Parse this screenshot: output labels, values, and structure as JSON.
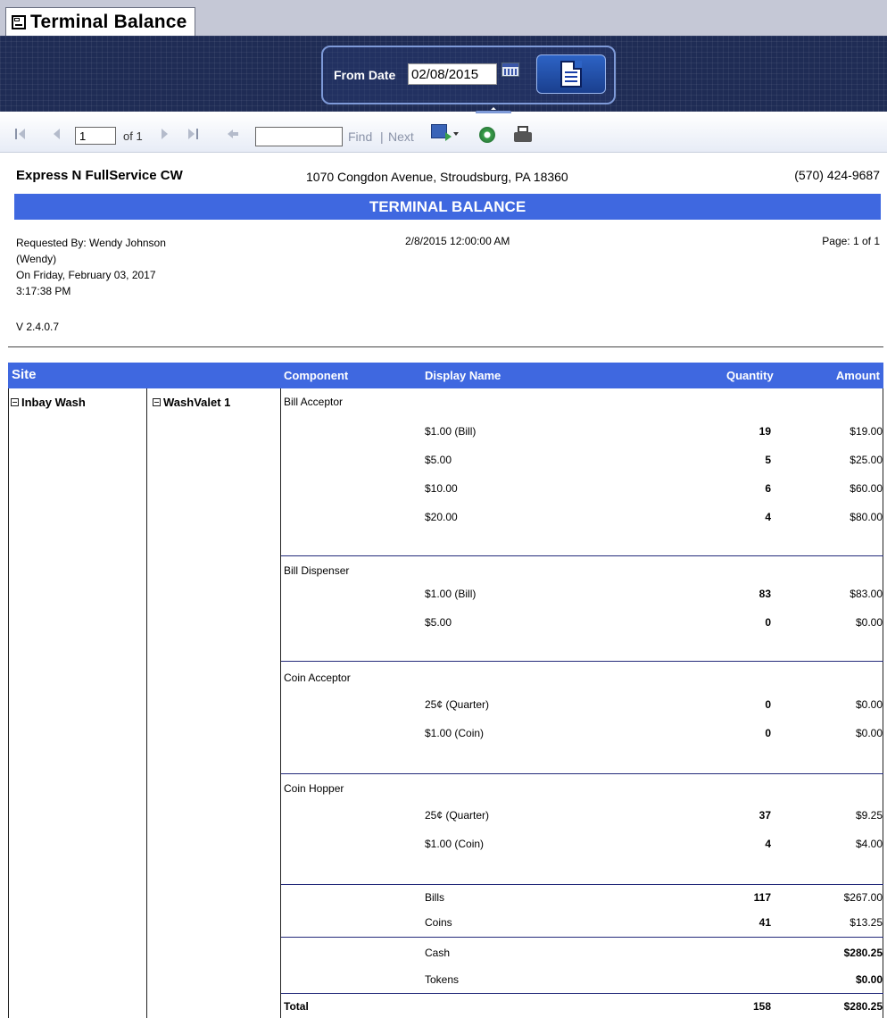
{
  "window": {
    "title": "Terminal Balance"
  },
  "params": {
    "from_date_label": "From Date",
    "from_date_value": "02/08/2015"
  },
  "toolbar": {
    "page_value": "1",
    "page_of": "of 1",
    "find_label": "Find",
    "separator": "|",
    "next_label": "Next"
  },
  "report": {
    "company": "Express N FullService CW",
    "address": "1070 Congdon Avenue, Stroudsburg, PA 18360",
    "phone": "(570) 424-9687",
    "title": "TERMINAL BALANCE",
    "requested_by": "Requested By: Wendy Johnson",
    "requested_user": "(Wendy)",
    "requested_on": "On Friday, February 03, 2017",
    "requested_time": "3:17:38 PM",
    "param_date": "2/8/2015 12:00:00 AM",
    "page": "Page: 1 of 1",
    "version": "V 2.4.0.7"
  },
  "table": {
    "headers": {
      "site": "Site",
      "component": "Component",
      "display_name": "Display Name",
      "quantity": "Quantity",
      "amount": "Amount"
    },
    "site": "Inbay Wash",
    "terminal": "WashValet 1",
    "groups": [
      {
        "component": "Bill Acceptor",
        "rows": [
          {
            "name": "$1.00 (Bill)",
            "qty": "19",
            "amount": "$19.00"
          },
          {
            "name": "$5.00",
            "qty": "5",
            "amount": "$25.00"
          },
          {
            "name": "$10.00",
            "qty": "6",
            "amount": "$60.00"
          },
          {
            "name": "$20.00",
            "qty": "4",
            "amount": "$80.00"
          }
        ]
      },
      {
        "component": "Bill Dispenser",
        "rows": [
          {
            "name": "$1.00 (Bill)",
            "qty": "83",
            "amount": "$83.00"
          },
          {
            "name": "$5.00",
            "qty": "0",
            "amount": "$0.00"
          }
        ]
      },
      {
        "component": "Coin Acceptor",
        "rows": [
          {
            "name": "25¢ (Quarter)",
            "qty": "0",
            "amount": "$0.00"
          },
          {
            "name": "$1.00 (Coin)",
            "qty": "0",
            "amount": "$0.00"
          }
        ]
      },
      {
        "component": "Coin Hopper",
        "rows": [
          {
            "name": "25¢ (Quarter)",
            "qty": "37",
            "amount": "$9.25"
          },
          {
            "name": "$1.00 (Coin)",
            "qty": "4",
            "amount": "$4.00"
          }
        ]
      }
    ],
    "summary": [
      {
        "name": "Bills",
        "qty": "117",
        "amount": "$267.00"
      },
      {
        "name": "Coins",
        "qty": "41",
        "amount": "$13.25"
      },
      {
        "name": "Cash",
        "qty": "",
        "amount": "$280.25"
      },
      {
        "name": "Tokens",
        "qty": "",
        "amount": "$0.00"
      }
    ],
    "total": {
      "label": "Total",
      "qty": "158",
      "amount": "$280.25"
    }
  }
}
